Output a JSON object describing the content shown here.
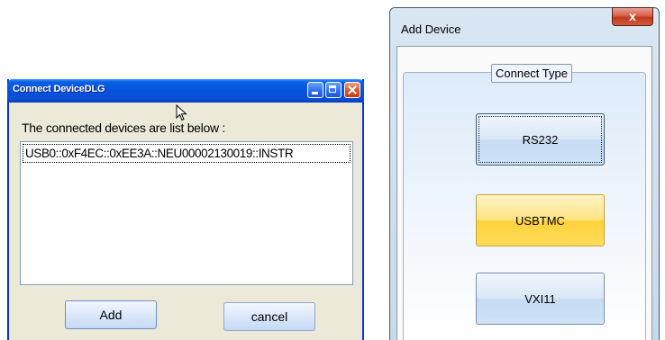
{
  "connect_dialog": {
    "title": "Connect DeviceDLG",
    "caption": "The connected devices are list below :",
    "devices": [
      "USB0::0xF4EC::0xEE3A::NEU00002130019::INSTR"
    ],
    "add_label": "Add",
    "cancel_label": "cancel"
  },
  "add_device_dialog": {
    "title": "Add Device",
    "close_glyph": "x",
    "group_label": "Connect Type",
    "buttons": {
      "rs232": "RS232",
      "usbtmc": "USBTMC",
      "vxi11": "VXI11"
    }
  }
}
